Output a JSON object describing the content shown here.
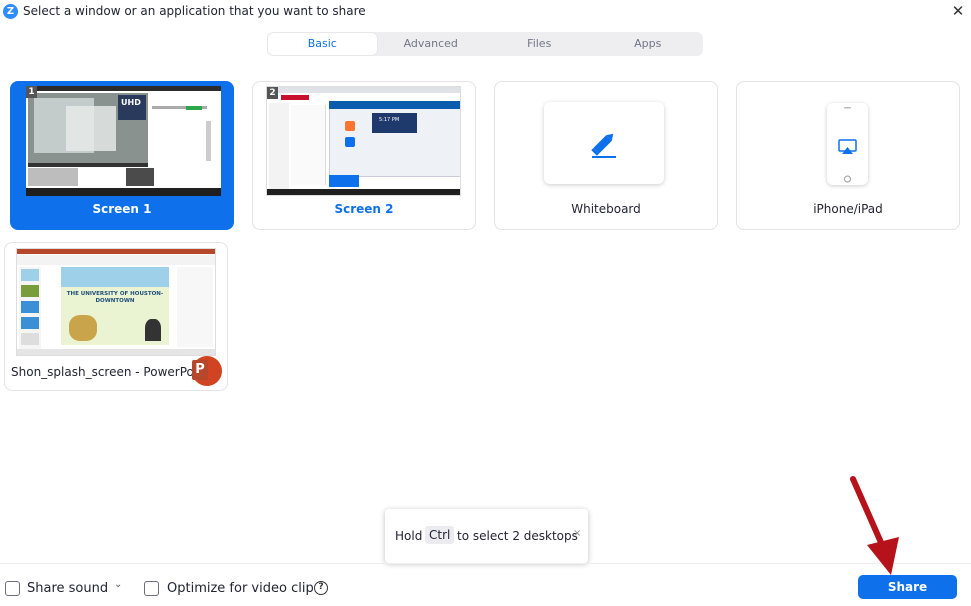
{
  "window": {
    "title": "Select a window or an application that you want to share",
    "logo_letter": "Z",
    "close_glyph": "✕"
  },
  "tabs": [
    {
      "label": "Basic",
      "active": true
    },
    {
      "label": "Advanced",
      "active": false
    },
    {
      "label": "Files",
      "active": false
    },
    {
      "label": "Apps",
      "active": false
    }
  ],
  "tiles": [
    {
      "label": "Screen 1",
      "number": "1",
      "selected": true
    },
    {
      "label": "Screen 2",
      "number": "2",
      "selected": false
    },
    {
      "label": "Whiteboard",
      "icon": "pen-icon"
    },
    {
      "label": "iPhone/iPad",
      "icon": "airplay-icon"
    },
    {
      "label": "Shon_splash_screen - PowerPoint",
      "icon": "powerpoint-icon",
      "badge_letter": "P"
    }
  ],
  "thumbnail_text": {
    "uhd_logo": "UHD",
    "screen2_time": "5:17 PM",
    "ppt_slide_title": "THE UNIVERSITY OF HOUSTON-DOWNTOWN"
  },
  "tooltip": {
    "before": "Hold",
    "key": "Ctrl",
    "after": "to select 2 desktops",
    "close_glyph": "×"
  },
  "bottom": {
    "share_sound_label": "Share sound",
    "optimize_label": "Optimize for video clip",
    "help_glyph": "?",
    "chevron_glyph": "⌄",
    "share_button_label": "Share"
  },
  "colors": {
    "accent": "#0e71eb",
    "annotation_arrow": "#b5121b"
  }
}
